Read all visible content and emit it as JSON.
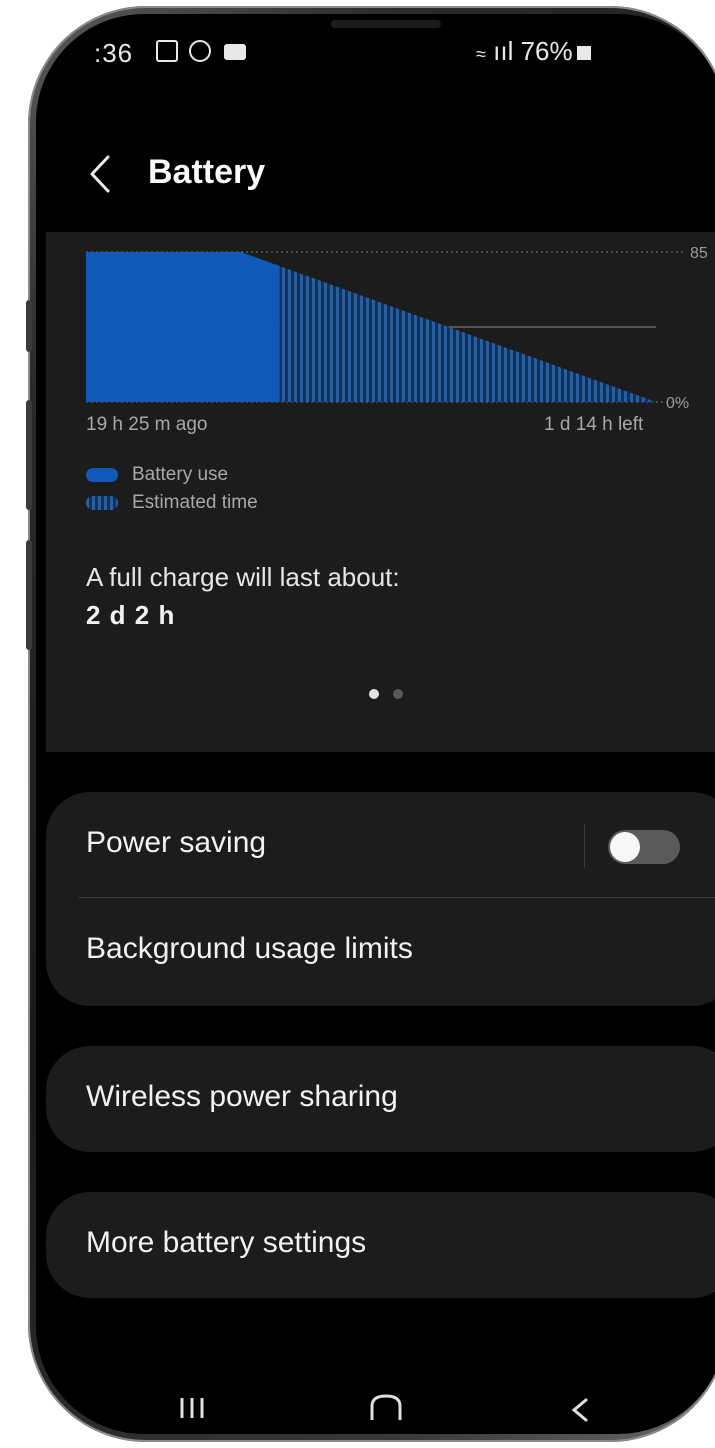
{
  "status_bar": {
    "time": ":36",
    "signal_text": "ııl 76%",
    "icons": [
      "gallery-icon",
      "alert-icon",
      "video-icon",
      "wifi-icon",
      "signal-icon",
      "battery-icon"
    ]
  },
  "header": {
    "title": "Battery",
    "back_icon": "back-arrow-icon"
  },
  "chart_data": {
    "type": "area",
    "y_ticks": [
      "85",
      "0%"
    ],
    "x_start_label": "19 h 25 m ago",
    "x_end_label": "1 d 14 h left",
    "series": [
      {
        "name": "Battery use",
        "values": [
          85,
          85,
          85,
          85,
          77
        ],
        "color": "#1059b8"
      },
      {
        "name": "Estimated time",
        "values": [
          77,
          0
        ],
        "color": "#1a4a86"
      }
    ],
    "ylim": [
      0,
      85
    ],
    "grid": true,
    "legend_position": "bottom-left"
  },
  "summary": {
    "full_charge_label": "A full charge will last about:",
    "full_charge_value": "2 d 2 h"
  },
  "pager": {
    "count": 2,
    "active": 0
  },
  "settings": {
    "group1": [
      {
        "label": "Power saving",
        "toggle": false
      },
      {
        "label": "Background usage limits"
      }
    ],
    "group2": [
      {
        "label": "Wireless power sharing"
      }
    ],
    "group3": [
      {
        "label": "More battery settings"
      }
    ]
  },
  "nav_bar": {
    "icons": [
      "recent-apps-icon",
      "home-icon",
      "back-icon"
    ]
  }
}
